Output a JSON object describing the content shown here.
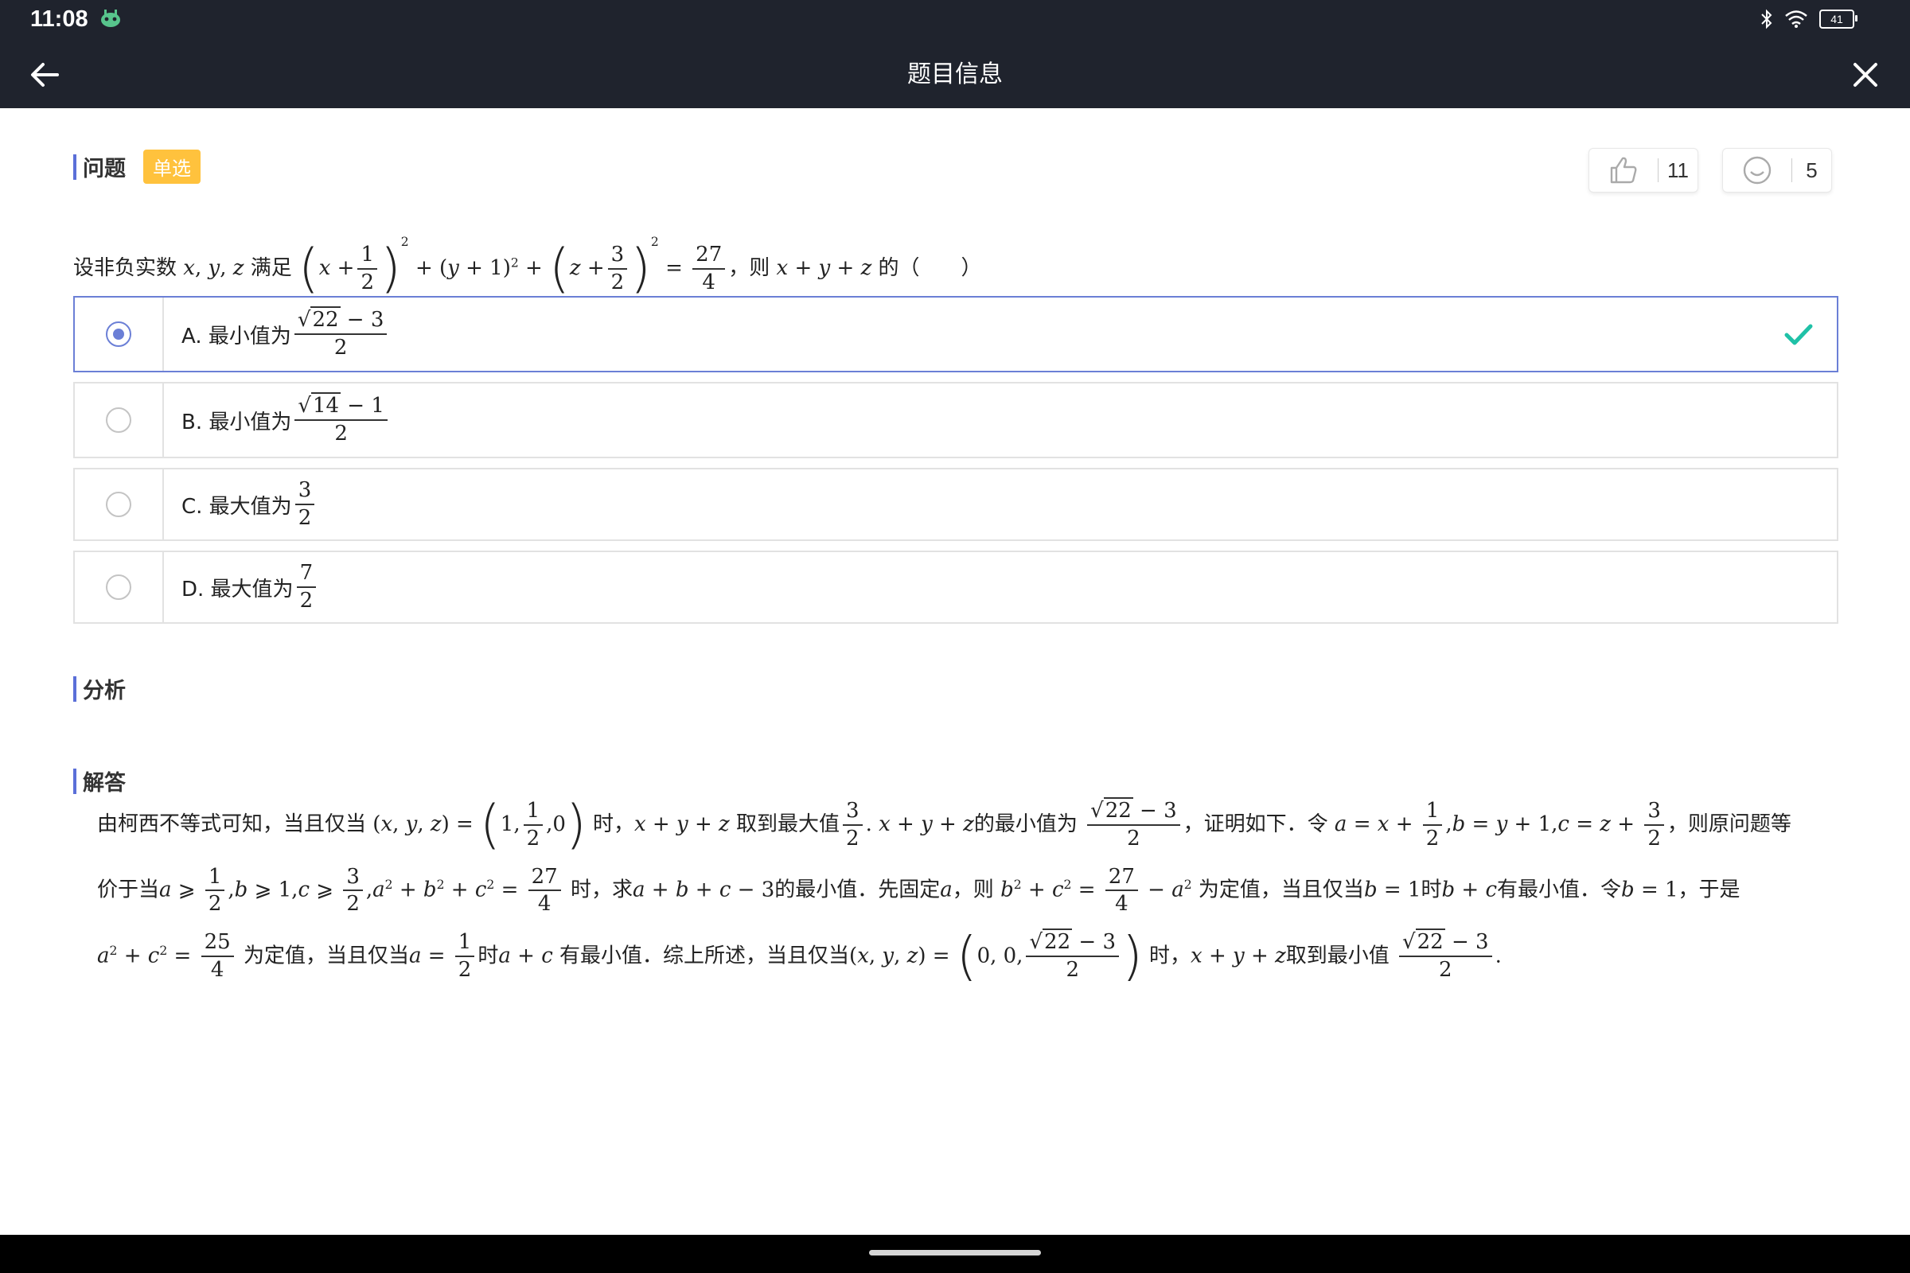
{
  "status_bar": {
    "time": "11:08",
    "battery": "41"
  },
  "header": {
    "title": "题目信息"
  },
  "question_section": {
    "title": "问题",
    "tag": "单选",
    "likes": "11",
    "reactions": "5",
    "stem": "设非负实数 x, y, z 满足 (x + 1/2)^2 + (y + 1)^2 + (z + 3/2)^2 = 27/4，则 x + y + z 的（　　）",
    "stem_prefix": "设非负实数",
    "stem_mid": "满足",
    "stem_suffix": "，则",
    "stem_end": "的（　　）"
  },
  "options": [
    {
      "prefix": "A. 最小值为",
      "radical": "22",
      "minus": "1",
      "num_tail": "3",
      "den": "2",
      "selected": true,
      "correct": true
    },
    {
      "prefix": "B. 最小值为",
      "radical": "14",
      "num_tail": "1",
      "den": "2",
      "selected": false
    },
    {
      "prefix": "C. 最大值为",
      "num": "3",
      "den": "2",
      "selected": false
    },
    {
      "prefix": "D. 最大值为",
      "num": "7",
      "den": "2",
      "selected": false
    }
  ],
  "analysis_section": {
    "title": "分析"
  },
  "solution_section": {
    "title": "解答",
    "t1": "由柯西不等式可知，当且仅当",
    "t2": "时，",
    "t3": "取到最大值",
    "t4": "的最小值为",
    "t5": "，证明如下．令",
    "t6": "，则原问题等",
    "t7": "价于当",
    "t8": "时，求",
    "t9": "的最小值．先固定",
    "t10": "，则",
    "t11": "为定值，当且仅当",
    "t12": "时",
    "t13": "有最小值．令",
    "t14": "，于是",
    "t15": "为定值，当且仅当",
    "t16": "时",
    "t17": "有最小值．综上所述，当且仅当",
    "t18": "时，",
    "t19": "取到最小值"
  },
  "colors": {
    "topbar": "#1f232d",
    "accent": "#5b6fd8",
    "tag": "#ffc23d",
    "check": "#1fc1a7"
  },
  "icons": [
    "back-arrow-icon",
    "close-icon",
    "thumbs-up-icon",
    "smiley-icon",
    "check-icon",
    "bluetooth-icon",
    "wifi-icon",
    "battery-icon"
  ]
}
